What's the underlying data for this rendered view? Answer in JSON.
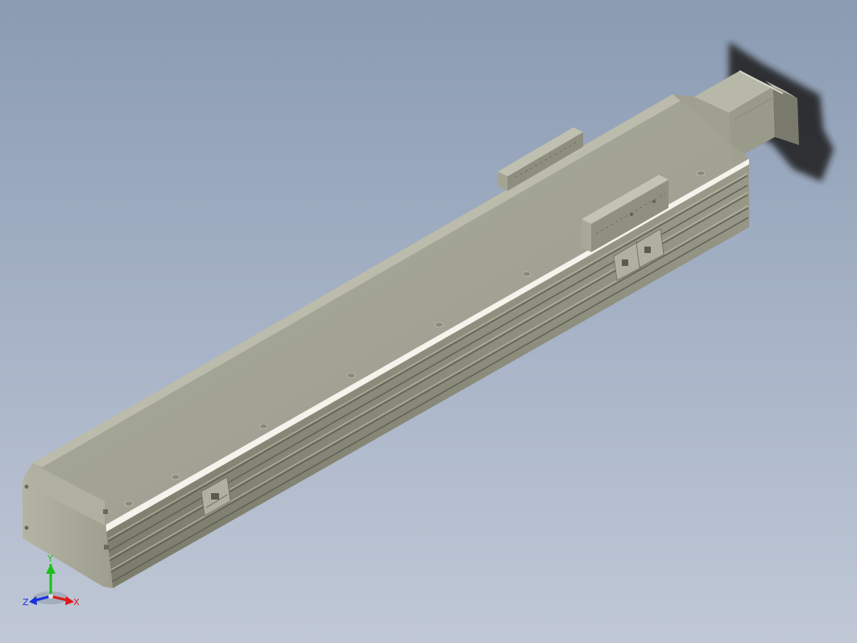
{
  "viewport": {
    "model": "linear-actuator-assembly",
    "background_top": "#8a9bb2",
    "background_bottom": "#c0c8d6",
    "body_color": "#a6a696"
  },
  "triad": {
    "x_label": "X",
    "y_label": "Y",
    "z_label": "Z",
    "x_color": "#e01818",
    "y_color": "#18c018",
    "z_color": "#1830e0"
  }
}
